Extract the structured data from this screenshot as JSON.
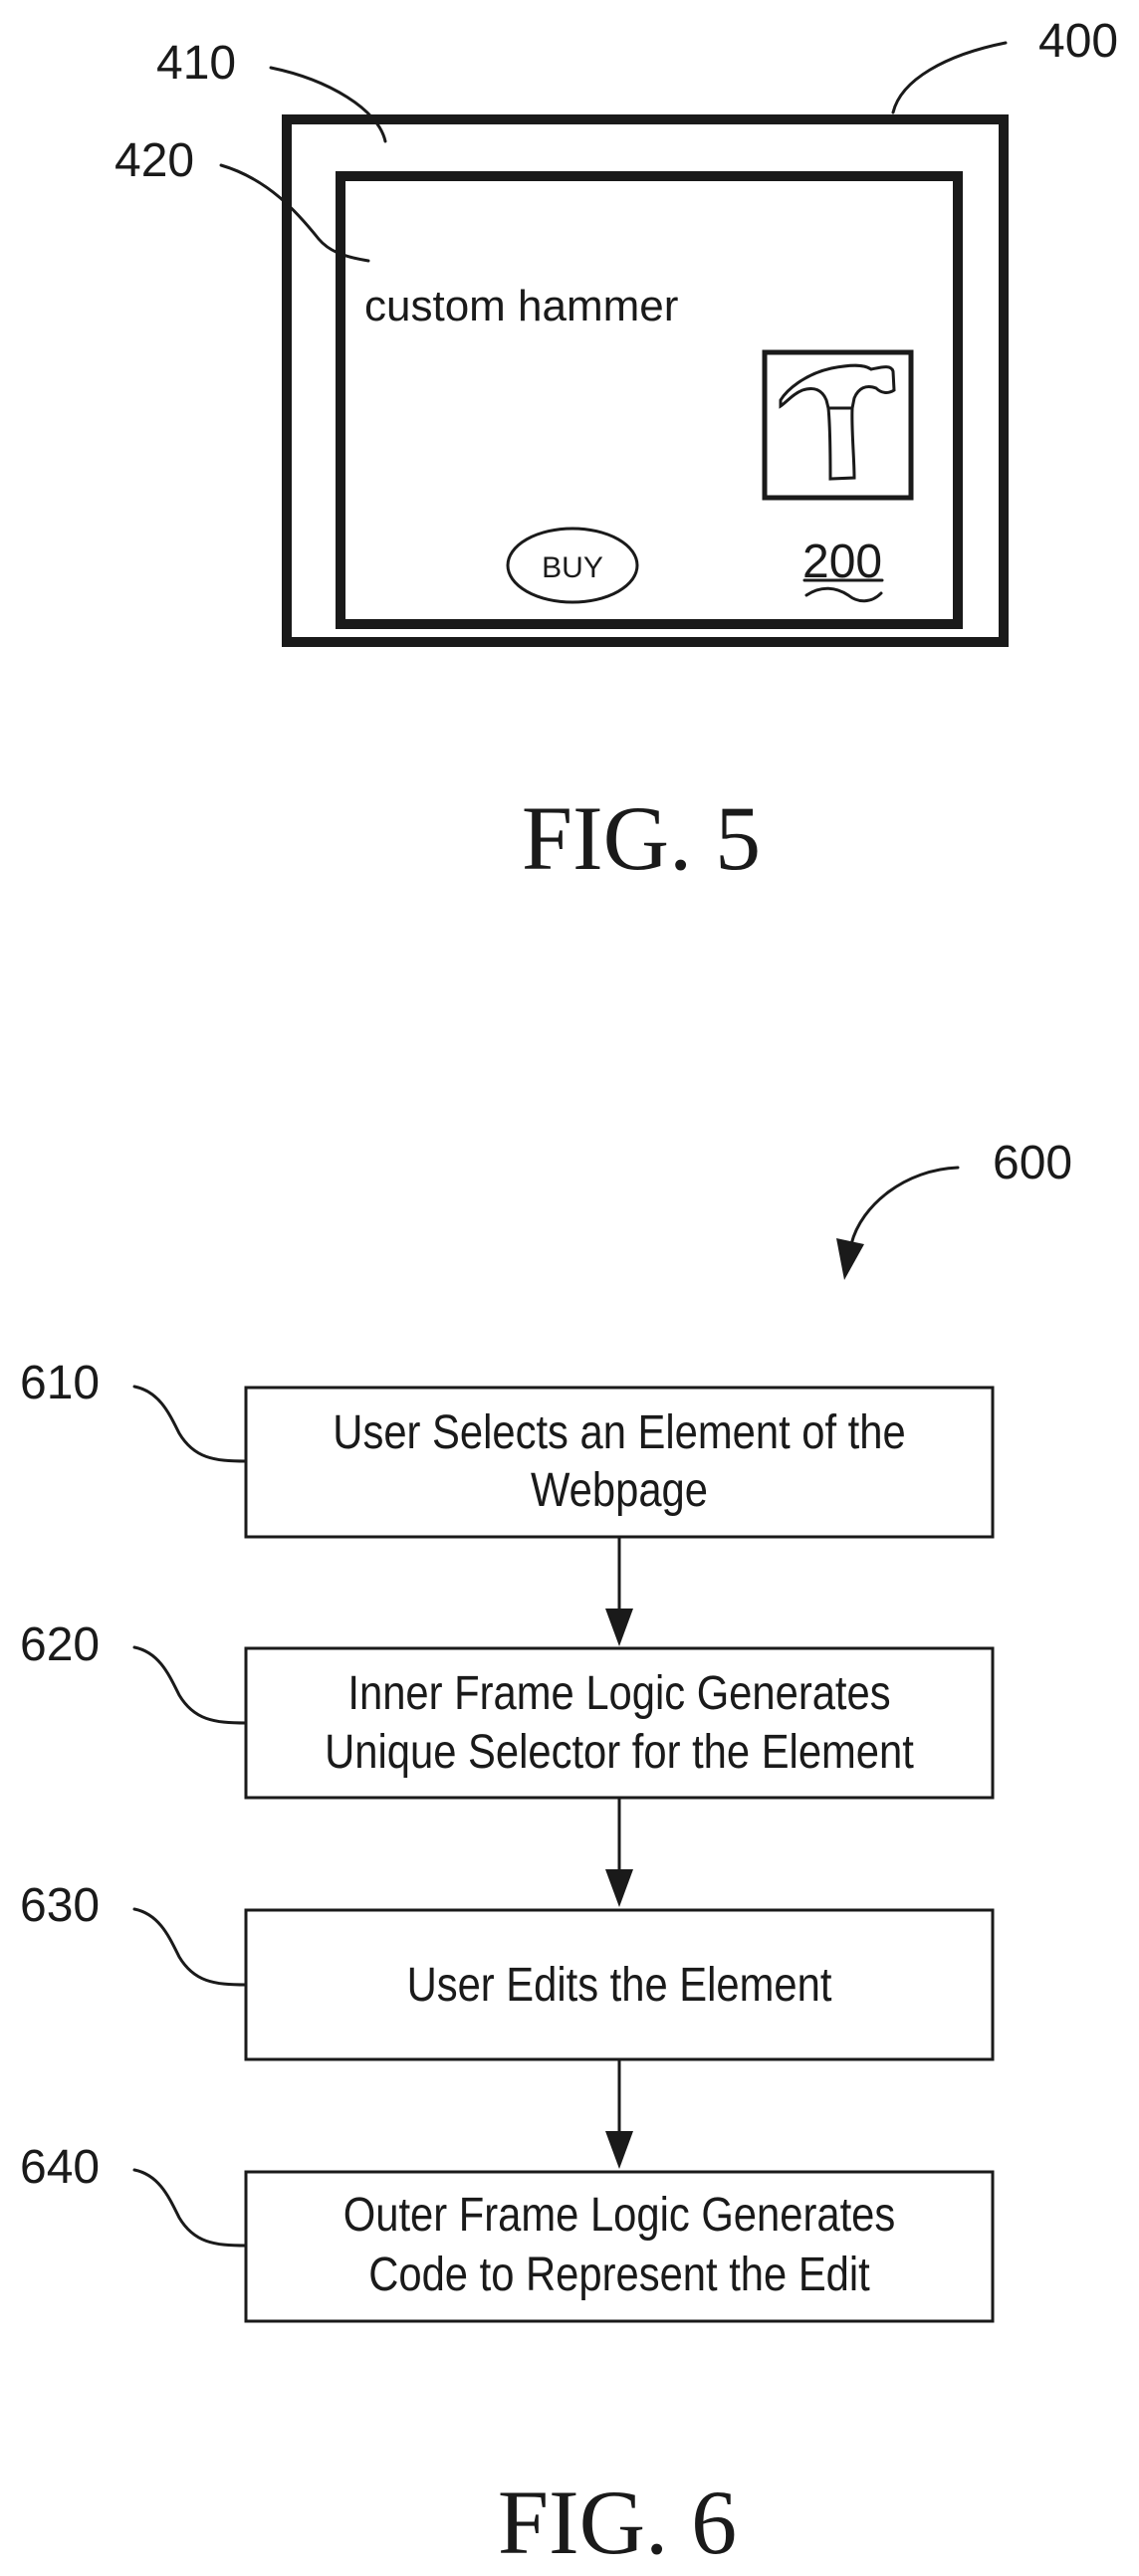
{
  "fig5": {
    "caption": "FIG. 5",
    "refs": {
      "outer_frame": "400",
      "outer_frame_area": "410",
      "inner_frame": "420",
      "webpage": "200"
    },
    "webpage": {
      "product_title": "custom hammer",
      "product_image_icon": "hammer-icon",
      "buy_button_label": "BUY"
    }
  },
  "fig6": {
    "caption": "FIG. 6",
    "ref": "600",
    "steps": [
      {
        "ref": "610",
        "lines": [
          "User Selects an Element of the",
          "Webpage"
        ]
      },
      {
        "ref": "620",
        "lines": [
          "Inner Frame Logic Generates",
          "Unique Selector for the Element"
        ]
      },
      {
        "ref": "630",
        "lines": [
          "User Edits the Element"
        ]
      },
      {
        "ref": "640",
        "lines": [
          "Outer Frame Logic Generates",
          "Code to Represent the Edit"
        ]
      }
    ]
  }
}
